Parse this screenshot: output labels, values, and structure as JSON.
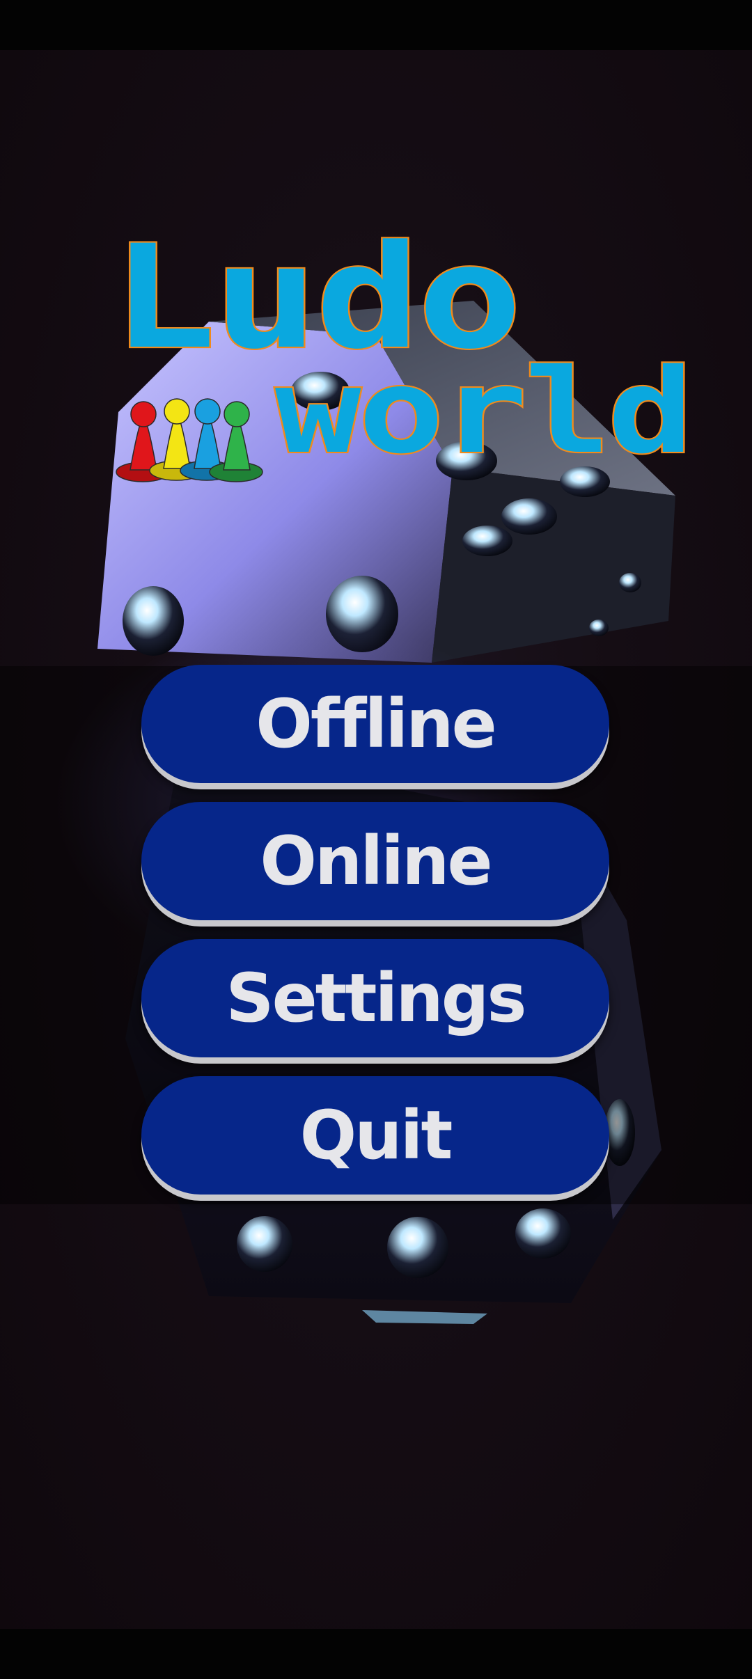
{
  "logo": {
    "line1": "Ludo",
    "line2": "world"
  },
  "menu": {
    "items": [
      {
        "label": "Offline"
      },
      {
        "label": "Online"
      },
      {
        "label": "Settings"
      },
      {
        "label": "Quit"
      }
    ]
  },
  "colors": {
    "button_fill": "#06268a",
    "button_shadow": "#c8c8cc",
    "button_text": "#e6e6ea",
    "logo_fill": "#0aa8df",
    "logo_outline": "#f08a1c",
    "background": "#150d14",
    "pawn_colors": [
      "#e0161b",
      "#f3e514",
      "#1aa0e0",
      "#2fb34a"
    ]
  },
  "icons": [
    "pawns-icon",
    "dice-art"
  ]
}
